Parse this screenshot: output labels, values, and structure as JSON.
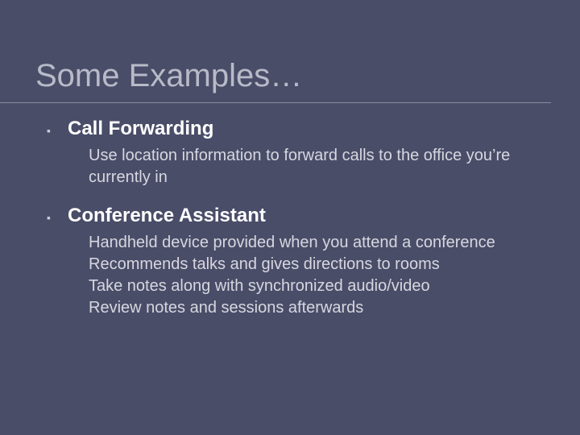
{
  "title": "Some Examples…",
  "items": [
    {
      "bullet": "▪",
      "heading": "Call Forwarding",
      "details": [
        "Use location information to forward calls to the office you’re currently in"
      ]
    },
    {
      "bullet": "▪",
      "heading": "Conference Assistant",
      "details": [
        "Handheld device provided when you attend a conference",
        "Recommends talks and gives directions to rooms",
        "Take notes along with synchronized audio/video",
        "Review notes and sessions afterwards"
      ]
    }
  ]
}
